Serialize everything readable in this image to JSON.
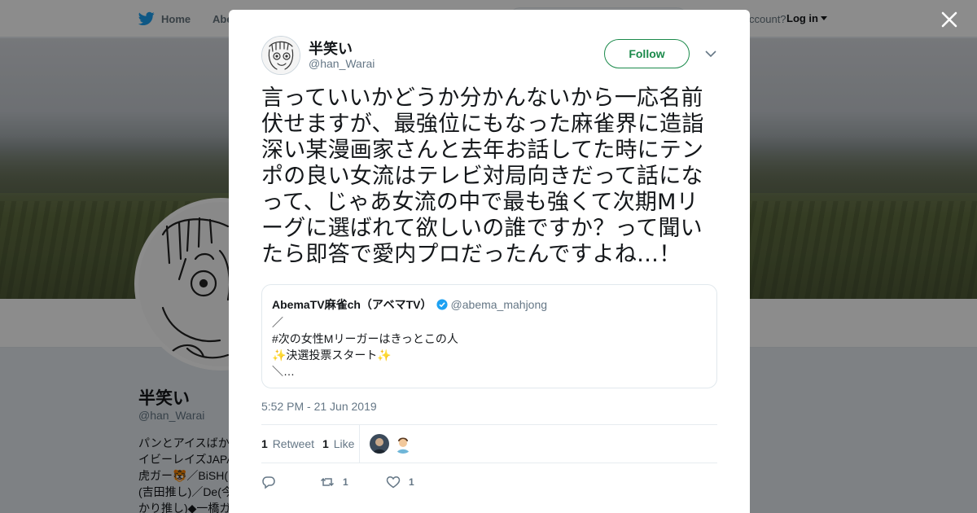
{
  "nav": {
    "home_label": "Home",
    "abe_label": "Abe",
    "account_prompt": "ccount?",
    "login_label": "Log in"
  },
  "background_profile": {
    "name": "半笑い",
    "handle": "@han_Warai",
    "bio_lines": [
      "パンとアイスばか",
      "イビーレイズJAPA",
      "虎ガー🐯／BiSH(",
      "(吉田推し)／De(今",
      "かり推し)◆一橋ガ"
    ]
  },
  "tweet": {
    "author_name": "半笑い",
    "author_handle": "@han_Warai",
    "follow_label": "Follow",
    "text": "言っていいかどうか分かんないから一応名前伏せますが、最強位にもなった麻雀界に造詣深い某漫画家さんと去年お話してた時にテンポの良い女流はテレビ対局向きだって話になって、じゃあ女流の中で最も強くて次期Mリーグに選ばれて欲しいの誰ですか？って聞いたら即答で愛内プロだったんですよね…！",
    "quoted": {
      "name": "AbemaTV麻雀ch（アベマTV）",
      "handle": "@abema_mahjong",
      "lines": [
        "／",
        "#次の女性Mリーガーはきっとこの人",
        "✨決選投票スタート✨",
        "＼…"
      ]
    },
    "timestamp": "5:52 PM - 21 Jun 2019",
    "retweet_count": "1",
    "retweet_label": "Retweet",
    "like_count": "1",
    "like_label": "Like",
    "action_retweet_count": "1",
    "action_like_count": "1"
  },
  "colors": {
    "follow_green": "#1b8a4b",
    "verified_blue": "#1da1f2",
    "muted_text": "#657786"
  },
  "icons": [
    "twitter-bird-icon",
    "close-icon",
    "chevron-down-icon",
    "verified-badge-icon",
    "reply-icon",
    "retweet-icon",
    "heart-icon"
  ]
}
